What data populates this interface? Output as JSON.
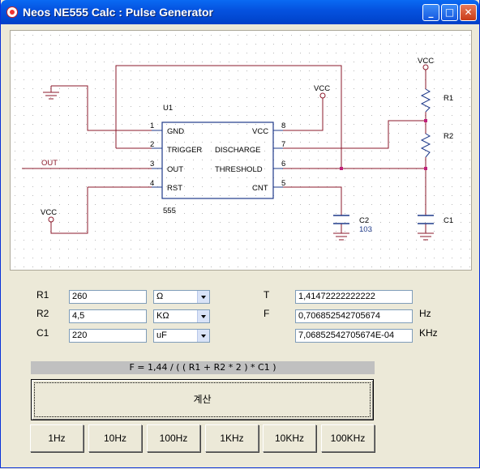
{
  "window": {
    "title": "Neos NE555 Calc : Pulse Generator",
    "controls": {
      "minimize": "_",
      "maximize": "□",
      "close": "✕"
    }
  },
  "schematic": {
    "chip_name": "U1",
    "chip_part": "555",
    "pins": [
      {
        "number": "1",
        "label": "GND"
      },
      {
        "number": "2",
        "label": "TRIGGER"
      },
      {
        "number": "3",
        "label": "OUT"
      },
      {
        "number": "4",
        "label": "RST"
      },
      {
        "number": "8",
        "label": "VCC"
      },
      {
        "number": "7",
        "label": "DISCHARGE"
      },
      {
        "number": "6",
        "label": "THRESHOLD"
      },
      {
        "number": "5",
        "label": "CNT"
      }
    ],
    "out_label": "OUT",
    "vcc_labels": [
      "VCC",
      "VCC",
      "VCC"
    ],
    "r1_label": "R1",
    "r2_label": "R2",
    "c1_label": "C1",
    "c2_label": "C2",
    "c2_value": "103",
    "wire_color": "#8b1a2b",
    "component_color": "#1f3a8a"
  },
  "form": {
    "r1": {
      "label": "R1",
      "value": "260",
      "unit": "Ω"
    },
    "r2": {
      "label": "R2",
      "value": "4,5",
      "unit": "KΩ"
    },
    "c1": {
      "label": "C1",
      "value": "220",
      "unit": "uF"
    },
    "t": {
      "label": "T",
      "value": "1,41472222222222"
    },
    "f": {
      "label": "F",
      "value": "0,706852542705674",
      "unit": "Hz"
    },
    "fk": {
      "value": "7,06852542705674E-04",
      "unit": "KHz"
    }
  },
  "formula": "F = 1,44 / ( ( R1 + R2 * 2 ) * C1 )",
  "calculate_label": "계산",
  "freq_buttons": [
    "1Hz",
    "10Hz",
    "100Hz",
    "1KHz",
    "10KHz",
    "100KHz"
  ]
}
